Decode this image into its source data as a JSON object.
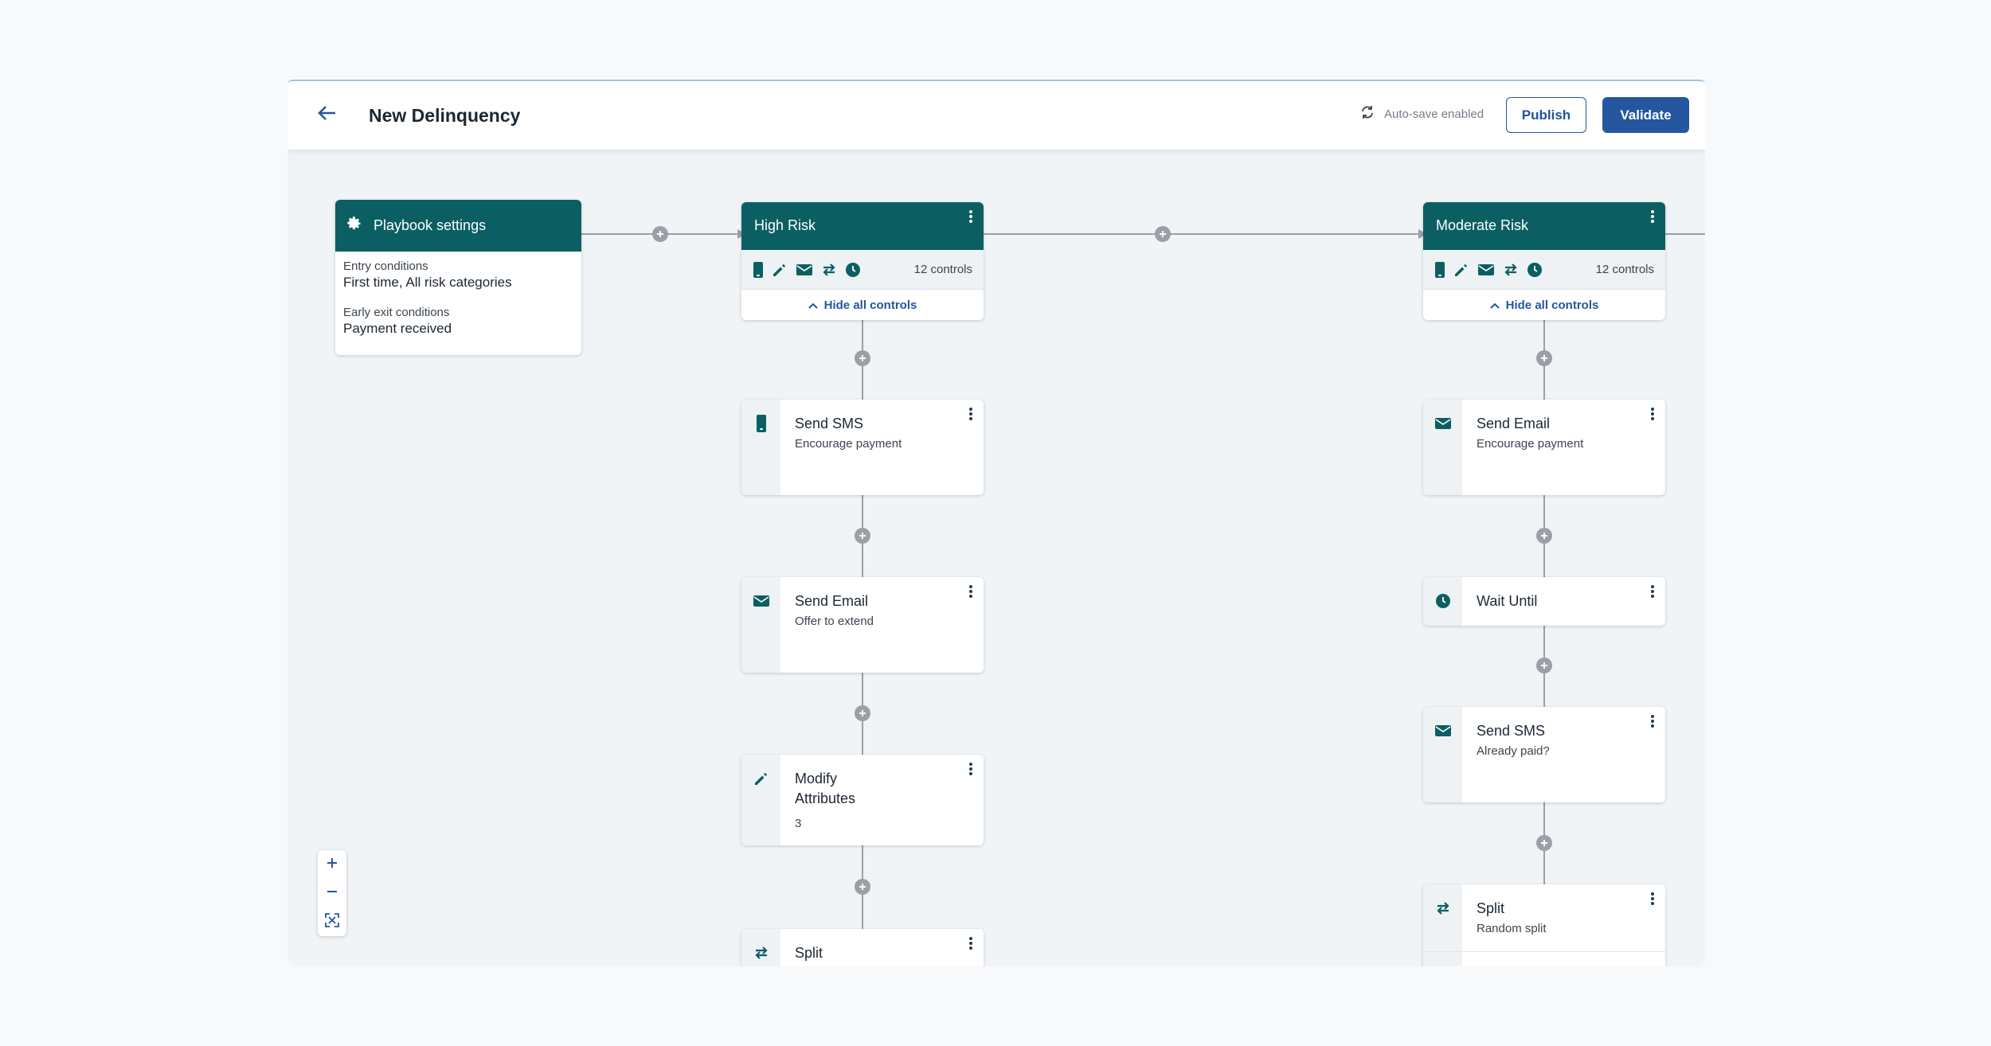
{
  "header": {
    "title": "New Delinquency",
    "autosave": "Auto-save enabled",
    "publish_label": "Publish",
    "validate_label": "Validate"
  },
  "settings": {
    "title": "Playbook settings",
    "entry_label": "Entry conditions",
    "entry_value": "First time, All risk categories",
    "exit_label": "Early exit conditions",
    "exit_value": "Payment received"
  },
  "branches": [
    {
      "title": "High Risk",
      "controls_count": "12 controls",
      "hide_label": "Hide all controls",
      "control_icons": [
        "sms-icon",
        "pencil-icon",
        "email-icon",
        "split-icon",
        "clock-icon"
      ],
      "steps": [
        {
          "title": "Send SMS",
          "subtitle": "Encourage payment",
          "icon": "sms-icon"
        },
        {
          "title": "Send Email",
          "subtitle": "Offer to extend",
          "icon": "email-icon"
        },
        {
          "title": "Modify Attributes",
          "subtitle": "3",
          "icon": "pencil-icon"
        },
        {
          "title": "Split",
          "subtitle": "",
          "icon": "split-icon"
        }
      ]
    },
    {
      "title": "Moderate Risk",
      "controls_count": "12 controls",
      "hide_label": "Hide all controls",
      "control_icons": [
        "sms-icon",
        "pencil-icon",
        "email-icon",
        "split-icon",
        "clock-icon"
      ],
      "steps": [
        {
          "title": "Send Email",
          "subtitle": "Encourage payment",
          "icon": "email-icon"
        },
        {
          "title": "Wait Until",
          "subtitle": "",
          "icon": "clock-icon"
        },
        {
          "title": "Send SMS",
          "subtitle": "Already paid?",
          "icon": "email-icon"
        },
        {
          "title": "Split",
          "subtitle": "Random split",
          "icon": "split-icon"
        }
      ]
    }
  ],
  "colors": {
    "teal": "#0b5f62",
    "primary": "#24579f",
    "canvas": "#f1f4f7"
  }
}
